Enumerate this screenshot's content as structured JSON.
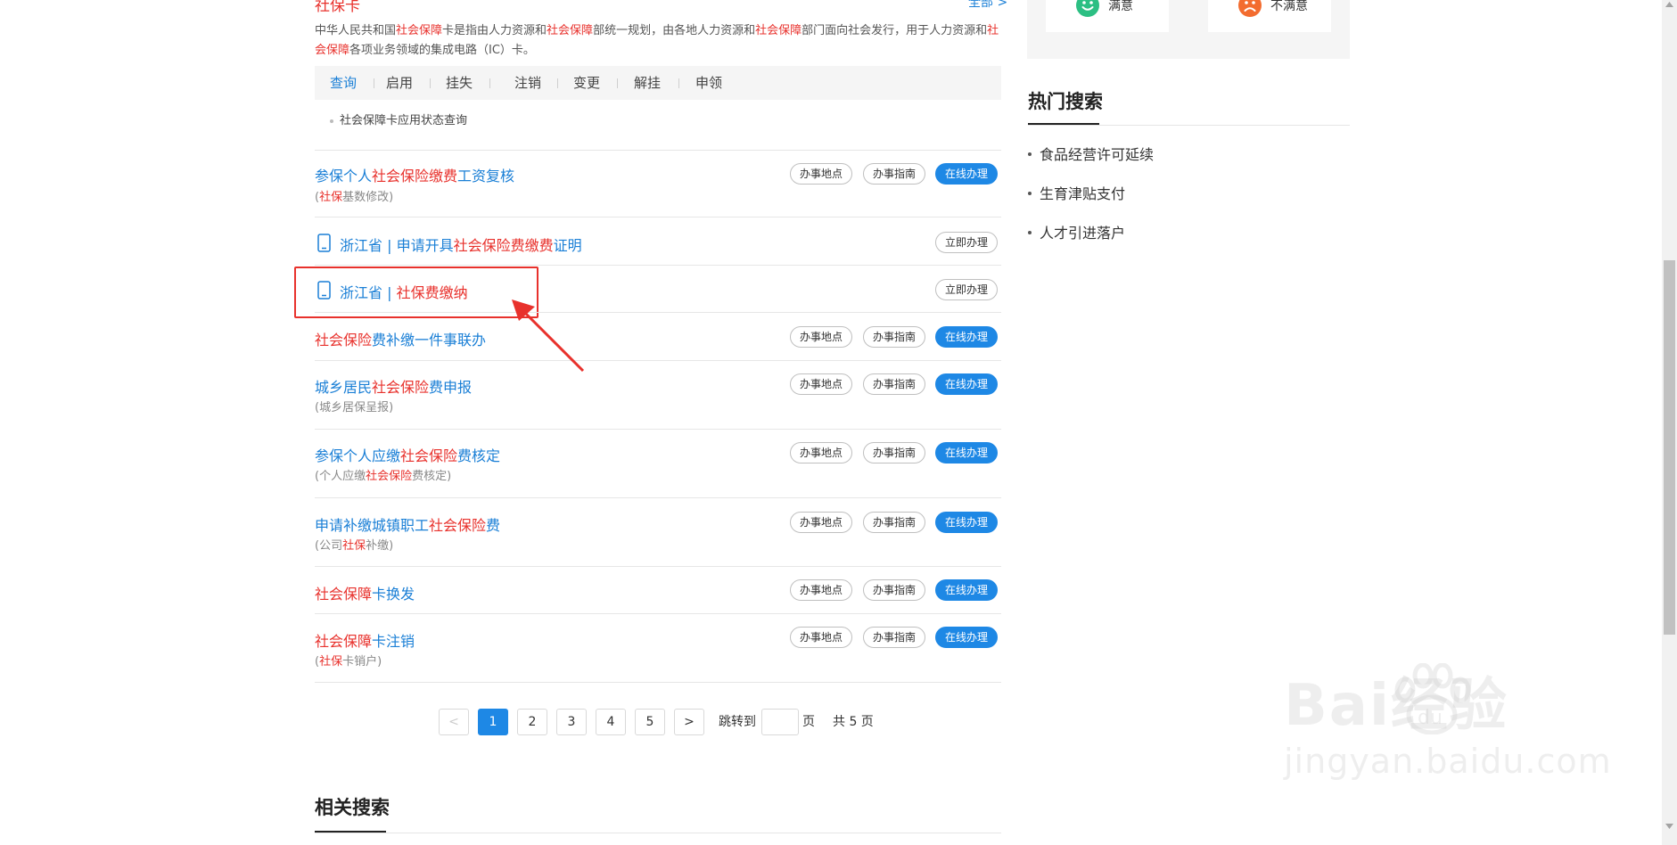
{
  "card": {
    "title": "社保卡",
    "all_link": "全部 >",
    "desc_parts": [
      "中华人民共和国",
      "社会保障",
      "卡是指由人力资源和",
      "社会保障",
      "部统一规划，由各地人力资源和",
      "社会保障",
      "部门面向社会发行，用于人力资源和",
      "社会保障",
      "各项业务领域的集成电路（IC）卡。"
    ],
    "tabs": [
      "查询",
      "启用",
      "挂失",
      "注销",
      "变更",
      "解挂",
      "申领"
    ],
    "sub_item": "社会保障卡应用状态查询"
  },
  "buttons": {
    "location": "办事地点",
    "guide": "办事指南",
    "online": "在线办理",
    "now": "立即办理"
  },
  "services": [
    {
      "t": [
        "参保个人",
        "社会保险缴费",
        "工资复核"
      ],
      "s": [
        "(",
        "社保",
        "基数修改)"
      ]
    },
    {
      "t": [
        "浙江省 | 申请开具",
        "社会保险费缴费",
        "证明"
      ]
    },
    {
      "t": [
        "浙江省 | ",
        "社保费缴纳"
      ]
    },
    {
      "t": [
        "",
        "社会保险",
        "费补缴一件事联办"
      ]
    },
    {
      "t": [
        "城乡居民",
        "社会保险",
        "费申报"
      ],
      "s": [
        "(城乡居保呈报)"
      ]
    },
    {
      "t": [
        "参保个人应缴",
        "社会保险",
        "费核定"
      ],
      "s": [
        "(个人应缴",
        "社会保险",
        "费核定)"
      ]
    },
    {
      "t": [
        "申请补缴城镇职工",
        "社会保险",
        "费"
      ],
      "s": [
        "(公司",
        "社保",
        "补缴)"
      ]
    },
    {
      "t": [
        "",
        "社会保障",
        "卡换发"
      ]
    },
    {
      "t": [
        "",
        "社会保障",
        "卡注销"
      ],
      "s": [
        "(",
        "社保",
        "卡销户)"
      ]
    }
  ],
  "pagination": {
    "prev": "<",
    "pages": [
      "1",
      "2",
      "3",
      "4",
      "5"
    ],
    "next": ">",
    "goto_label": "跳转到",
    "page_unit": "页",
    "total": "共 5 页"
  },
  "related": {
    "title": "相关搜索"
  },
  "satisfaction": {
    "good": "满意",
    "bad": "不满意"
  },
  "hot": {
    "title": "热门搜索",
    "items": [
      "食品经营许可延续",
      "生育津贴支付",
      "人才引进落户"
    ]
  },
  "watermark": {
    "main": "Bai经验",
    "du": "du",
    "sub": "jingyan.baidu.com"
  },
  "colors": {
    "accent": "#1e88e5",
    "highlight": "#e8312c",
    "good": "#2cbf83",
    "bad": "#f36c2f"
  }
}
